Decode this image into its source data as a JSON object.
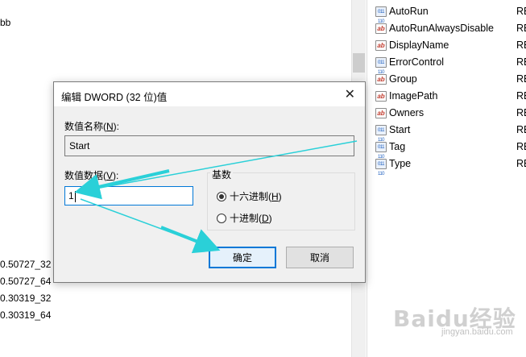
{
  "tree": {
    "partial_items": [
      "bb",
      "0.50727_32",
      "0.50727_64",
      "0.30319_32",
      "0.30319_64"
    ]
  },
  "values": [
    {
      "name": "AutoRun",
      "kind": "bin",
      "type": "RE"
    },
    {
      "name": "AutoRunAlwaysDisable",
      "kind": "ab",
      "type": "RE"
    },
    {
      "name": "DisplayName",
      "kind": "ab",
      "type": "RE"
    },
    {
      "name": "ErrorControl",
      "kind": "bin",
      "type": "RE"
    },
    {
      "name": "Group",
      "kind": "ab",
      "type": "RE"
    },
    {
      "name": "ImagePath",
      "kind": "ab",
      "type": "RE"
    },
    {
      "name": "Owners",
      "kind": "ab",
      "type": "RE"
    },
    {
      "name": "Start",
      "kind": "bin",
      "type": "RE"
    },
    {
      "name": "Tag",
      "kind": "bin",
      "type": "RE"
    },
    {
      "name": "Type",
      "kind": "bin",
      "type": "RE"
    }
  ],
  "icons": {
    "string": "ab",
    "binary": "011 110"
  },
  "dialog": {
    "title": "编辑 DWORD (32 位)值",
    "close_glyph": "✕",
    "name_label_text": "数值名称(",
    "name_label_key": "N",
    "name_label_end": "):",
    "name_value": "Start",
    "data_label_text": "数值数据(",
    "data_label_key": "V",
    "data_label_end": "):",
    "data_value": "1",
    "base_title": "基数",
    "hex_text": "十六进制(",
    "hex_key": "H",
    "hex_end": ")",
    "dec_text": "十进制(",
    "dec_key": "D",
    "dec_end": ")",
    "selected_base": "hex",
    "ok_label": "确定",
    "cancel_label": "取消"
  },
  "colors": {
    "accent": "#0078d7",
    "arrow": "#2ad0d8"
  },
  "watermark": {
    "text": "Baidu经验",
    "sub": "jingyan.baidu.com"
  }
}
